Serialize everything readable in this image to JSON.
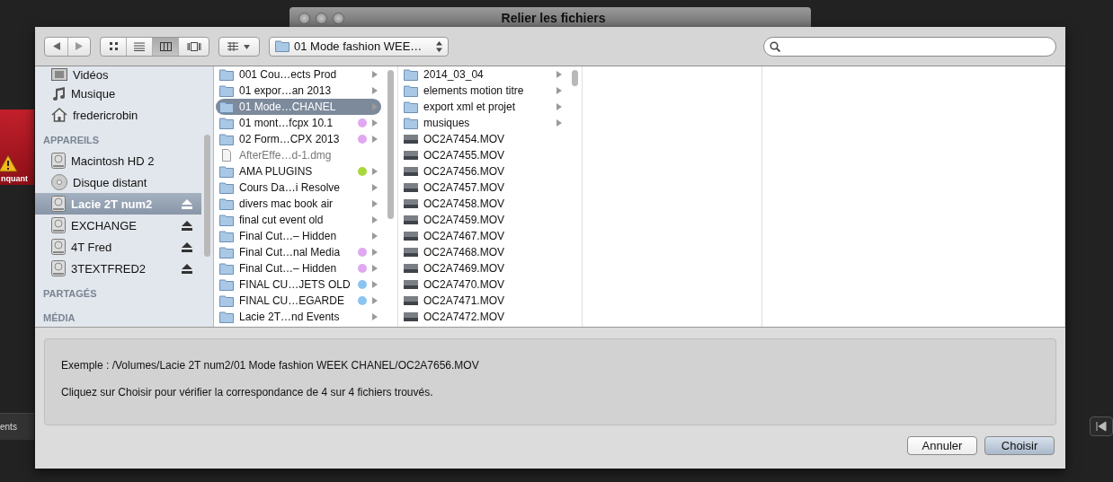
{
  "background": {
    "window_title": "Relier les fichiers",
    "alert_label": "nquant",
    "side_label": "ents"
  },
  "toolbar": {
    "view_modes": [
      {
        "kind": "icons",
        "selected": false
      },
      {
        "kind": "list",
        "selected": false
      },
      {
        "kind": "columns",
        "selected": true
      },
      {
        "kind": "coverflow",
        "selected": false
      }
    ],
    "path_popup": "01 Mode fashion WEE…"
  },
  "sidebar": [
    {
      "kind": "movies",
      "label": "Vidéos",
      "selected": false,
      "eject": false
    },
    {
      "kind": "music",
      "label": "Musique",
      "selected": false,
      "eject": false
    },
    {
      "kind": "home",
      "label": "fredericrobin",
      "selected": false,
      "eject": false
    },
    {
      "kind": "heading",
      "label": "APPAREILS"
    },
    {
      "kind": "drive",
      "label": "Macintosh HD 2",
      "selected": false,
      "eject": false
    },
    {
      "kind": "optical",
      "label": "Disque distant",
      "selected": false,
      "eject": false
    },
    {
      "kind": "drive",
      "label": "Lacie 2T num2",
      "selected": true,
      "eject": true
    },
    {
      "kind": "drive",
      "label": "EXCHANGE",
      "selected": false,
      "eject": true
    },
    {
      "kind": "drive",
      "label": "4T Fred",
      "selected": false,
      "eject": true
    },
    {
      "kind": "drive",
      "label": "3TEXTFRED2",
      "selected": false,
      "eject": true
    },
    {
      "kind": "heading",
      "label": "PARTAGÉS"
    },
    {
      "kind": "heading",
      "label": "MÉDIA"
    }
  ],
  "columns": [
    {
      "items": [
        {
          "kind": "folder",
          "name": "001 Cou…ects Prod",
          "selected": false
        },
        {
          "kind": "folder",
          "name": "01 expor…an 2013",
          "selected": false
        },
        {
          "kind": "folder",
          "name": "01 Mode…CHANEL",
          "selected": true
        },
        {
          "kind": "folder",
          "name": "01 mont…fcpx 10.1",
          "selected": false,
          "color": "#e0a8f0"
        },
        {
          "kind": "folder",
          "name": "02 Form…CPX 2013",
          "selected": false,
          "color": "#e0a8f0"
        },
        {
          "kind": "document",
          "name": "AfterEffe…d-1.dmg",
          "selected": false
        },
        {
          "kind": "folder",
          "name": "AMA PLUGINS",
          "selected": false,
          "color": "#a8d83c"
        },
        {
          "kind": "folder",
          "name": "Cours Da…i Resolve",
          "selected": false
        },
        {
          "kind": "folder",
          "name": "divers mac book air",
          "selected": false
        },
        {
          "kind": "folder",
          "name": "final cut event old",
          "selected": false
        },
        {
          "kind": "folder",
          "name": "Final Cut…– Hidden",
          "selected": false
        },
        {
          "kind": "folder",
          "name": "Final Cut…nal Media",
          "selected": false,
          "color": "#e0a8f0"
        },
        {
          "kind": "folder",
          "name": "Final Cut…– Hidden",
          "selected": false,
          "color": "#e0a8f0"
        },
        {
          "kind": "folder",
          "name": "FINAL CU…JETS OLD",
          "selected": false,
          "color": "#8cc4f0"
        },
        {
          "kind": "folder",
          "name": "FINAL CU…EGARDE",
          "selected": false,
          "color": "#8cc4f0"
        },
        {
          "kind": "folder",
          "name": "Lacie 2T…nd Events",
          "selected": false
        }
      ]
    },
    {
      "items": [
        {
          "kind": "folder",
          "name": "2014_03_04",
          "selected": false
        },
        {
          "kind": "folder",
          "name": "elements motion titre",
          "selected": false
        },
        {
          "kind": "folder",
          "name": "export xml et projet",
          "selected": false
        },
        {
          "kind": "folder",
          "name": "musiques",
          "selected": false
        },
        {
          "kind": "movie",
          "name": "OC2A7454.MOV",
          "selected": false
        },
        {
          "kind": "movie",
          "name": "OC2A7455.MOV",
          "selected": false
        },
        {
          "kind": "movie",
          "name": "OC2A7456.MOV",
          "selected": false
        },
        {
          "kind": "movie",
          "name": "OC2A7457.MOV",
          "selected": false
        },
        {
          "kind": "movie",
          "name": "OC2A7458.MOV",
          "selected": false
        },
        {
          "kind": "movie",
          "name": "OC2A7459.MOV",
          "selected": false
        },
        {
          "kind": "movie",
          "name": "OC2A7467.MOV",
          "selected": false
        },
        {
          "kind": "movie",
          "name": "OC2A7468.MOV",
          "selected": false
        },
        {
          "kind": "movie",
          "name": "OC2A7469.MOV",
          "selected": false
        },
        {
          "kind": "movie",
          "name": "OC2A7470.MOV",
          "selected": false
        },
        {
          "kind": "movie",
          "name": "OC2A7471.MOV",
          "selected": false
        },
        {
          "kind": "movie",
          "name": "OC2A7472.MOV",
          "selected": false
        }
      ]
    }
  ],
  "info": {
    "example": "Exemple : /Volumes/Lacie 2T num2/01 Mode fashion WEEK CHANEL/OC2A7656.MOV",
    "message": "Cliquez sur Choisir pour vérifier la correspondance de 4 sur 4 fichiers trouvés."
  },
  "buttons": [
    {
      "label": "Annuler",
      "default": false
    },
    {
      "label": "Choisir",
      "default": true
    }
  ]
}
